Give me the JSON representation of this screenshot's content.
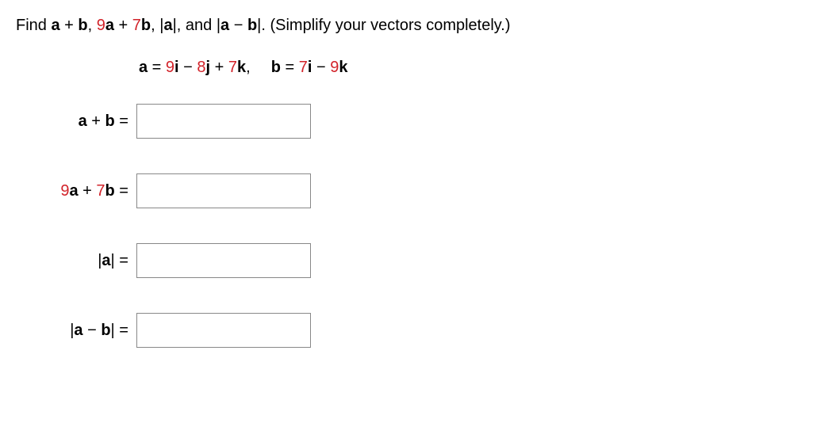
{
  "question": {
    "prefix": "Find ",
    "part1_a": "a",
    "part1_plus": " + ",
    "part1_b": "b",
    "sep1": ", ",
    "part2_9": "9",
    "part2_a": "a",
    "part2_plus": " + ",
    "part2_7": "7",
    "part2_b": "b",
    "sep2": ", ",
    "part3_bar1": "|",
    "part3_a": "a",
    "part3_bar2": "|",
    "sep3": ", and ",
    "part4_bar1": "|",
    "part4_a": "a",
    "part4_minus": " − ",
    "part4_b": "b",
    "part4_bar2": "|",
    "suffix": ". (Simplify your vectors completely.)"
  },
  "given": {
    "a_lhs": "a",
    "a_eq": " = ",
    "a_t1": "9",
    "a_i": "i",
    "a_t2": " − ",
    "a_t3": "8",
    "a_j": "j",
    "a_t4": " + ",
    "a_t5": "7",
    "a_k": "k",
    "a_comma": ",",
    "b_lhs": "b",
    "b_eq": " = ",
    "b_t1": "7",
    "b_i": "i",
    "b_t2": " − ",
    "b_t3": "9",
    "b_k": "k"
  },
  "rows": {
    "r1": {
      "a": "a",
      "plus": " + ",
      "b": "b",
      "eq": "  ="
    },
    "r2": {
      "nine": "9",
      "a": "a",
      "plus": " + ",
      "seven": "7",
      "b": "b",
      "eq": "  ="
    },
    "r3": {
      "bar1": "|",
      "a": "a",
      "bar2": "|",
      "eq": "  ="
    },
    "r4": {
      "bar1": "|",
      "a": "a",
      "minus": " − ",
      "b": "b",
      "bar2": "|",
      "eq": "  ="
    }
  },
  "inputs": {
    "r1": "",
    "r2": "",
    "r3": "",
    "r4": ""
  }
}
